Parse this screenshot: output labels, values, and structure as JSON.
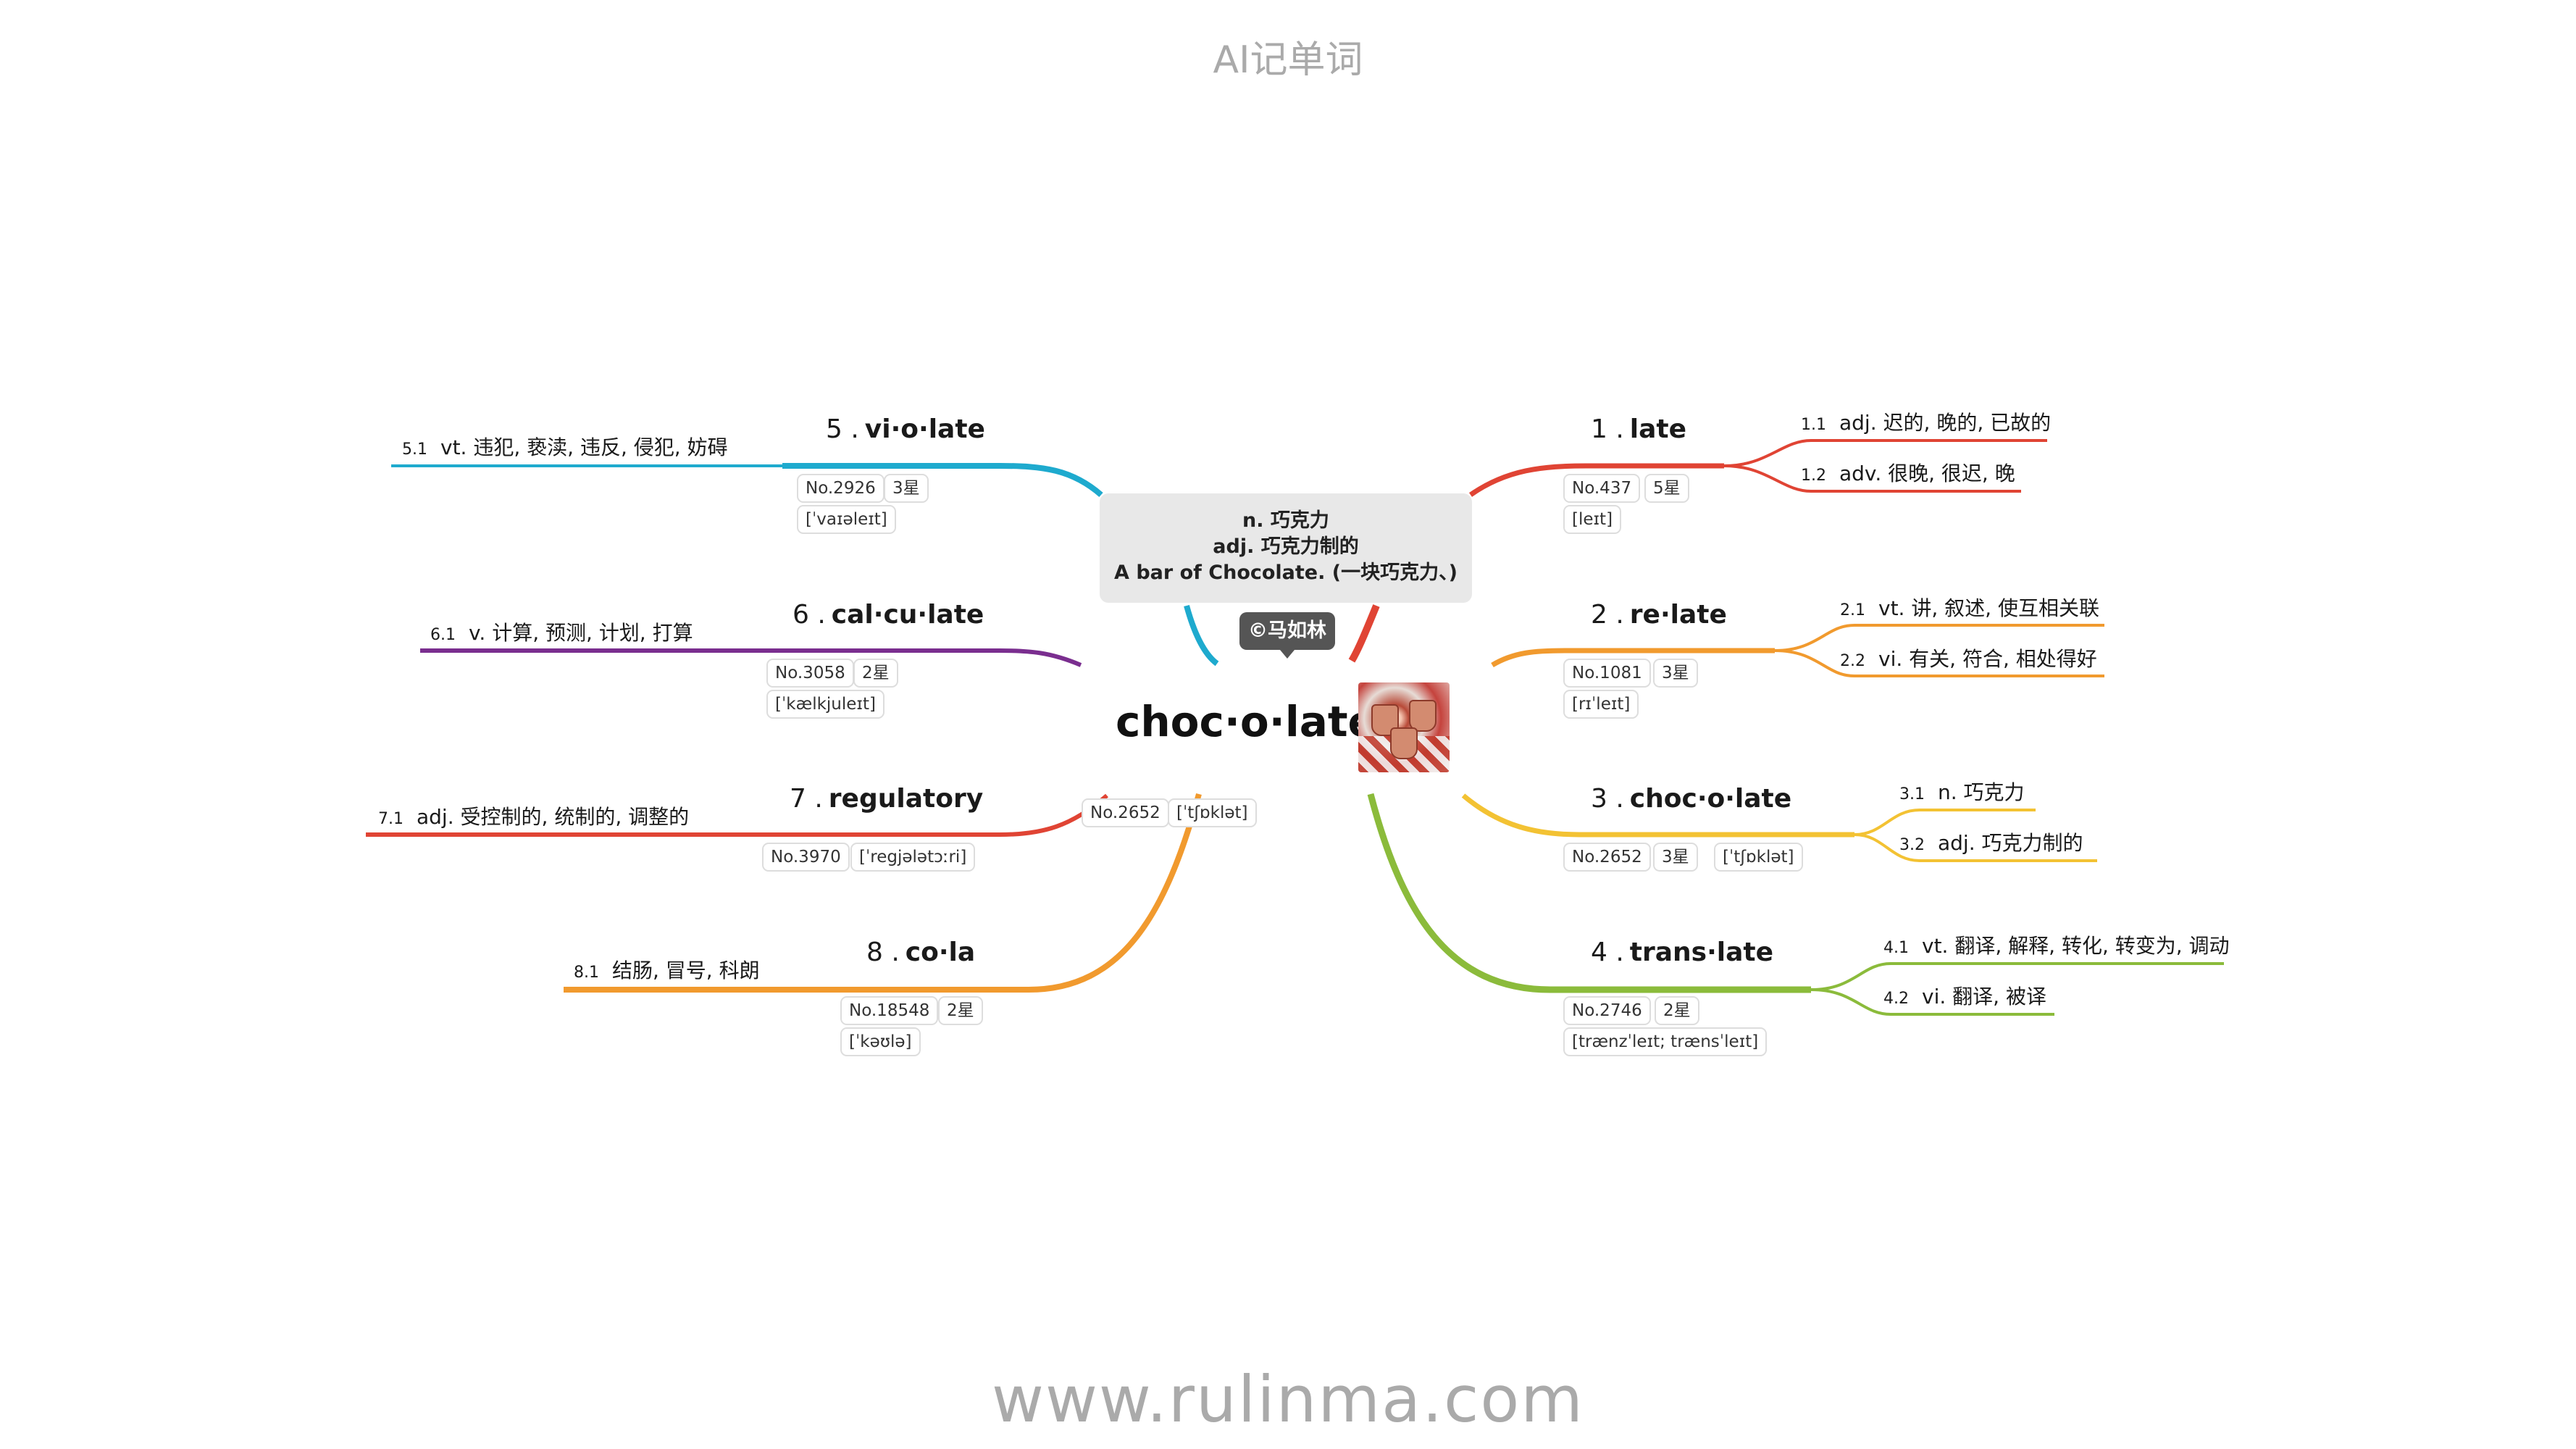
{
  "header": {
    "title": "AI记单词"
  },
  "footer": {
    "url": "www.rulinma.com"
  },
  "center": {
    "word": "choc·o·late",
    "no": "No.2652",
    "ipa": "[ˈtʃɒklət]",
    "note": [
      "n. 巧克力",
      "adj. 巧克力制的",
      "A bar of Chocolate. (一块巧克力、)"
    ],
    "copyright": "©马如林"
  },
  "colors": {
    "b1": "#e04434",
    "b2": "#f19a2e",
    "b3": "#f3c233",
    "b4": "#8bbb3b",
    "b5": "#1eaace",
    "b6": "#7a2e8f",
    "b7": "#e04434",
    "b8": "#f19a2e"
  },
  "branches": [
    {
      "num": "1 .",
      "word": "late",
      "no": "No.437",
      "stars": "5星",
      "ipa": "[leɪt]",
      "senses": [
        {
          "num": "1.1",
          "text": "adj. 迟的, 晚的, 已故的"
        },
        {
          "num": "1.2",
          "text": "adv. 很晚, 很迟, 晚"
        }
      ]
    },
    {
      "num": "2 .",
      "word": "re·late",
      "no": "No.1081",
      "stars": "3星",
      "ipa": "[rɪˈleɪt]",
      "senses": [
        {
          "num": "2.1",
          "text": "vt. 讲, 叙述, 使互相关联"
        },
        {
          "num": "2.2",
          "text": "vi. 有关, 符合, 相处得好"
        }
      ]
    },
    {
      "num": "3 .",
      "word": "choc·o·late",
      "no": "No.2652",
      "stars": "3星",
      "ipa": "[ˈtʃɒklət]",
      "senses": [
        {
          "num": "3.1",
          "text": "n. 巧克力"
        },
        {
          "num": "3.2",
          "text": "adj. 巧克力制的"
        }
      ]
    },
    {
      "num": "4 .",
      "word": "trans·late",
      "no": "No.2746",
      "stars": "2星",
      "ipa": "[trænzˈleɪt; trænsˈleɪt]",
      "senses": [
        {
          "num": "4.1",
          "text": "vt. 翻译, 解释, 转化, 转变为, 调动"
        },
        {
          "num": "4.2",
          "text": "vi. 翻译, 被译"
        }
      ]
    },
    {
      "num": "5 .",
      "word": "vi·o·late",
      "no": "No.2926",
      "stars": "3星",
      "ipa": "[ˈvaɪəleɪt]",
      "senses": [
        {
          "num": "5.1",
          "text": "vt. 违犯, 亵渎, 违反, 侵犯, 妨碍"
        }
      ]
    },
    {
      "num": "6 .",
      "word": "cal·cu·late",
      "no": "No.3058",
      "stars": "2星",
      "ipa": "[ˈkælkjuleɪt]",
      "senses": [
        {
          "num": "6.1",
          "text": "v. 计算, 预测, 计划, 打算"
        }
      ]
    },
    {
      "num": "7 .",
      "word": "regulatory",
      "no": "No.3970",
      "ipa": "[ˈregjələtɔːri]",
      "senses": [
        {
          "num": "7.1",
          "text": "adj. 受控制的, 统制的, 调整的"
        }
      ]
    },
    {
      "num": "8 .",
      "word": "co·la",
      "no": "No.18548",
      "stars": "2星",
      "ipa": "[ˈkəʊlə]",
      "senses": [
        {
          "num": "8.1",
          "text": "结肠, 冒号, 科朗"
        }
      ]
    }
  ]
}
